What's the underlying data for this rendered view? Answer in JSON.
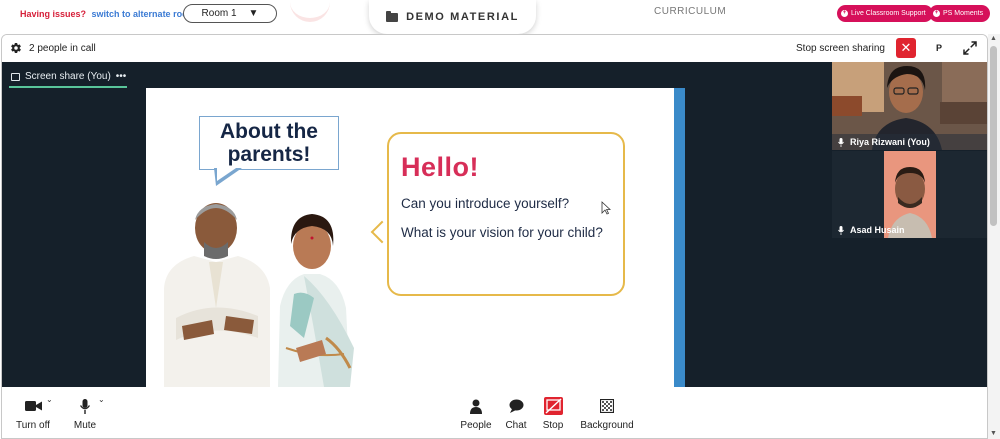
{
  "topbar": {
    "issues_text": "Having issues?",
    "switch_link": "switch to alternate room",
    "room_selected": "Room 1",
    "demo_tab_label": "DEMO MATERIAL",
    "curriculum_label": "CURRICULUM",
    "support_label": "Live Classroom Support",
    "moments_label": "PS Moments"
  },
  "call": {
    "people_count": "2 people in call",
    "stop_sharing_label": "Stop screen sharing",
    "p_button": "P",
    "share_tab_label": "Screen share (You)",
    "share_tab_more": "•••"
  },
  "slide": {
    "about_title": "About the parents!",
    "hello": "Hello!",
    "question_1": "Can you introduce yourself?",
    "question_2": "What is your vision for your child?"
  },
  "participants": [
    {
      "name": "Riya Rizwani (You)"
    },
    {
      "name": "Asad Husain"
    }
  ],
  "toolbar": {
    "camera": "Turn off",
    "mute": "Mute",
    "people": "People",
    "chat": "Chat",
    "stop": "Stop",
    "background": "Background"
  },
  "colors": {
    "accent_red": "#e0242f",
    "pill_pink": "#d6105a",
    "hello_pink": "#d72e58",
    "bubble_border": "#e6b94a",
    "stage_dark": "#15202a",
    "share_underline": "#59c59a"
  }
}
